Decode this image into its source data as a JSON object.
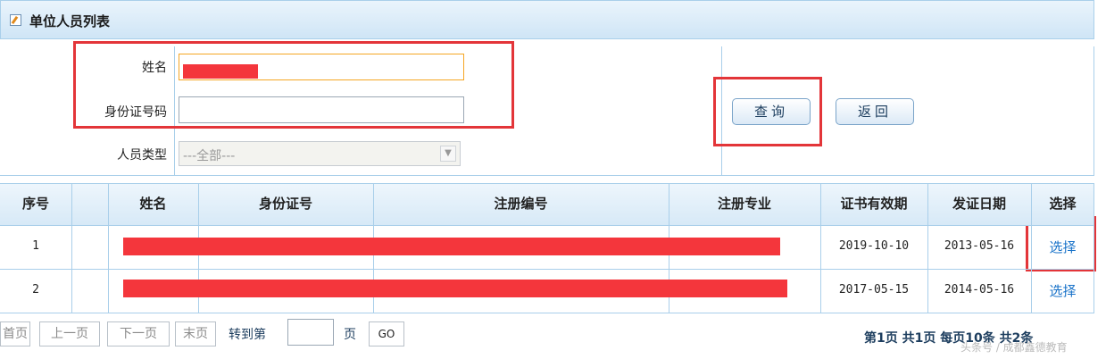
{
  "header": {
    "title": "单位人员列表",
    "icon": "edit-icon"
  },
  "form": {
    "name_label": "姓名",
    "idcard_label": "身份证号码",
    "type_label": "人员类型",
    "type_selected": "---全部---",
    "query_button": "查询",
    "back_button": "返回"
  },
  "table": {
    "headers": [
      "序号",
      "",
      "姓名",
      "身份证号",
      "注册编号",
      "注册专业",
      "证书有效期",
      "发证日期",
      "选择"
    ],
    "rows": [
      {
        "index": "1",
        "cert_valid": "2019-10-10",
        "issue_date": "2013-05-16",
        "action": "选择"
      },
      {
        "index": "2",
        "cert_valid": "2017-05-15",
        "issue_date": "2014-05-16",
        "action": "选择"
      }
    ]
  },
  "pager": {
    "first": "首页",
    "prev": "上一页",
    "next": "下一页",
    "last": "末页",
    "goto_prefix": "转到第",
    "goto_suffix": "页",
    "go_button": "GO",
    "info": "第1页  共1页  每页10条  共2条"
  },
  "watermark": "头条号 / 成都鑫德教育",
  "colors": {
    "highlight": "#e33539",
    "redaction": "#f4363c",
    "link": "#1a73c9",
    "border": "#a9cfea"
  }
}
